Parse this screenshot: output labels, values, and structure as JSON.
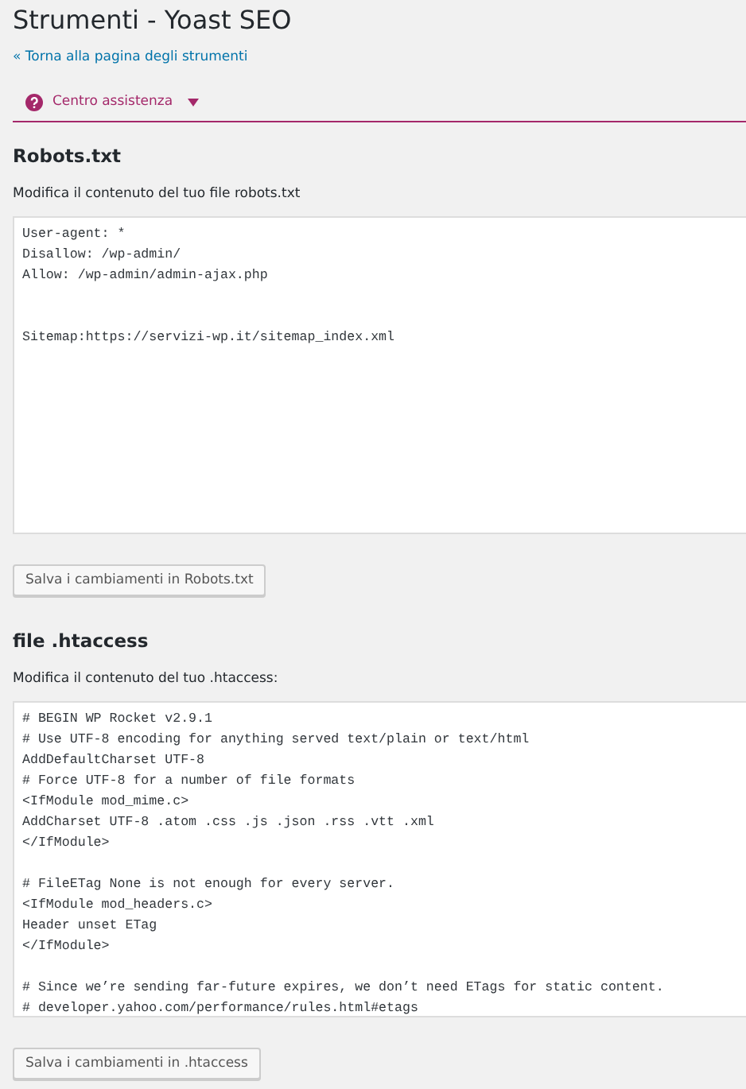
{
  "page": {
    "title": "Strumenti - Yoast SEO",
    "back_link": "« Torna alla pagina degli strumenti"
  },
  "help_tab": {
    "label": "Centro assistenza",
    "expanded": false
  },
  "sections": [
    {
      "heading": "Robots.txt",
      "description": "Modifica il contenuto del tuo file robots.txt",
      "content": "User-agent: *\nDisallow: /wp-admin/\nAllow: /wp-admin/admin-ajax.php\n\n\nSitemap:https://servizi-wp.it/sitemap_index.xml",
      "button": "Salva i cambiamenti in Robots.txt"
    },
    {
      "heading": "file .htaccess",
      "description": "Modifica il contenuto del tuo .htaccess:",
      "content": "# BEGIN WP Rocket v2.9.1\n# Use UTF-8 encoding for anything served text/plain or text/html\nAddDefaultCharset UTF-8\n# Force UTF-8 for a number of file formats\n<IfModule mod_mime.c>\nAddCharset UTF-8 .atom .css .js .json .rss .vtt .xml\n</IfModule>\n\n# FileETag None is not enough for every server.\n<IfModule mod_headers.c>\nHeader unset ETag\n</IfModule>\n\n# Since we’re sending far-future expires, we don’t need ETags for static content.\n# developer.yahoo.com/performance/rules.html#etags",
      "button": "Salva i cambiamenti in .htaccess"
    }
  ]
}
